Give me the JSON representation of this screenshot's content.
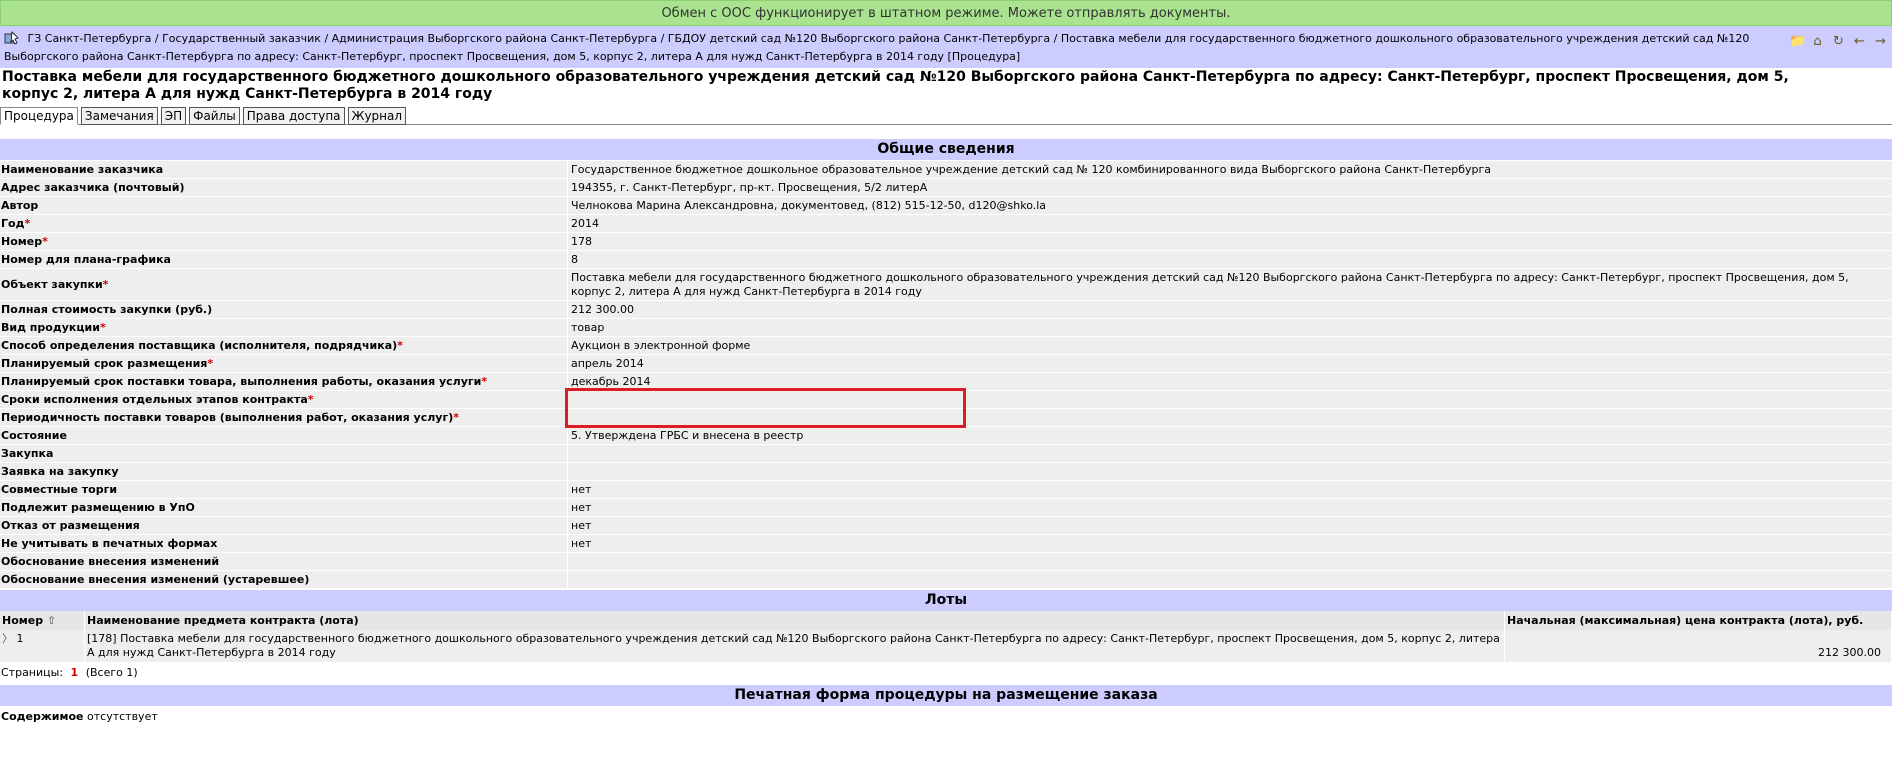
{
  "status": {
    "message": "Обмен с ООС функционирует в штатном режиме. Можете отправлять документы."
  },
  "breadcrumb": {
    "text": "ГЗ Санкт-Петербурга / Государственный заказчик / Администрация Выборгского района Санкт-Петербурга / ГБДОУ детский сад №120 Выборгского района Санкт-Петербурга / Поставка мебели для государственного бюджетного дошкольного образовательного учреждения детский сад №120 Выборгского района Санкт-Петербурга по адресу: Санкт-Петербург, проспект Просвещения, дом 5, корпус 2, литера А для нужд Санкт-Петербурга в 2014 году [Процедура]"
  },
  "toolbar": {
    "icons": [
      "folder-icon",
      "home-icon",
      "refresh-icon",
      "back-icon",
      "forward-icon"
    ]
  },
  "page": {
    "title": "Поставка мебели для государственного бюджетного дошкольного образовательного учреждения детский сад №120 Выборгского района Санкт-Петербурга по адресу: Санкт-Петербург, проспект Просвещения, дом 5, корпус 2, литера А для нужд Санкт-Петербурга в 2014 году"
  },
  "tabs": [
    "Процедура",
    "Замечания",
    "ЭП",
    "Файлы",
    "Права доступа",
    "Журнал"
  ],
  "general": {
    "header": "Общие сведения",
    "rows": [
      {
        "label": "Наименование заказчика",
        "value": "Государственное бюджетное дошкольное образовательное учреждение детский сад № 120 комбинированного вида Выборгского района Санкт-Петербурга",
        "req": ""
      },
      {
        "label": "Адрес заказчика (почтовый)",
        "value": "194355, г. Санкт-Петербург, пр-кт. Просвещения, 5/2 литерА",
        "req": ""
      },
      {
        "label": "Автор",
        "value": "Челнокова Марина Александровна, документовед, (812) 515-12-50, d120@shko.la",
        "req": ""
      },
      {
        "label": "Год",
        "value": "2014",
        "req": "*"
      },
      {
        "label": "Номер",
        "value": "178",
        "req": "*"
      },
      {
        "label": "Номер для плана-графика",
        "value": "8",
        "req": ""
      },
      {
        "label": "Объект закупки",
        "value": "Поставка мебели для государственного бюджетного дошкольного образовательного учреждения детский сад №120 Выборгского района Санкт-Петербурга по адресу: Санкт-Петербург, проспект Просвещения, дом 5, корпус 2, литера А для нужд Санкт-Петербурга в 2014 году",
        "req": "*"
      },
      {
        "label": "Полная стоимость закупки (руб.)",
        "value": "212 300.00",
        "req": ""
      },
      {
        "label": "Вид продукции",
        "value": "товар",
        "req": "*"
      },
      {
        "label": "Способ определения поставщика (исполнителя, подрядчика)",
        "value": "Аукцион в электронной форме",
        "req": "*"
      },
      {
        "label": "Планируемый срок размещения",
        "value": "апрель 2014",
        "req": "*"
      },
      {
        "label": "Планируемый срок поставки товара, выполнения работы, оказания услуги",
        "value": "декабрь 2014",
        "req": "*"
      },
      {
        "label": "Сроки исполнения отдельных этапов контракта",
        "value": "",
        "req": "*"
      },
      {
        "label": "Периодичность поставки товаров (выполнения работ, оказания услуг)",
        "value": "",
        "req": "*"
      },
      {
        "label": "Состояние",
        "value": "5. Утверждена ГРБС и внесена в реестр",
        "req": ""
      },
      {
        "label": "Закупка",
        "value": "",
        "req": ""
      },
      {
        "label": "Заявка на закупку",
        "value": "",
        "req": ""
      },
      {
        "label": "Совместные торги",
        "value": "нет",
        "req": ""
      },
      {
        "label": "Подлежит размещению в УпО",
        "value": "нет",
        "req": ""
      },
      {
        "label": "Отказ от размещения",
        "value": "нет",
        "req": ""
      },
      {
        "label": "Не учитывать в печатных формах",
        "value": "нет",
        "req": ""
      },
      {
        "label": "Обоснование внесения изменений",
        "value": "",
        "req": ""
      },
      {
        "label": "Обоснование внесения изменений (устаревшее)",
        "value": "",
        "req": ""
      }
    ]
  },
  "lots": {
    "header": "Лоты",
    "columns": {
      "number": "Номер",
      "name": "Наименование предмета контракта (лота)",
      "price": "Начальная (максимальная) цена контракта (лота), руб."
    },
    "rows": [
      {
        "number": "1",
        "name": "[178] Поставка мебели для государственного бюджетного дошкольного образовательного учреждения детский сад №120 Выборгского района Санкт-Петербурга по адресу: Санкт-Петербург, проспект Просвещения, дом 5, корпус 2, литера А для нужд Санкт-Петербурга в 2014 году",
        "price": "212 300.00"
      }
    ],
    "pager": {
      "label": "Страницы:",
      "current": "1",
      "total": "(Всего 1)"
    }
  },
  "print_form": {
    "header": "Печатная форма процедуры на размещение заказа",
    "label": "Содержимое",
    "value": "отсутствует"
  },
  "colors": {
    "status_bg": "#a9e38f",
    "header_bg": "#ccccff",
    "row_bg": "#eeeeee",
    "required": "#cc0000",
    "highlight": "#dd1c24"
  }
}
